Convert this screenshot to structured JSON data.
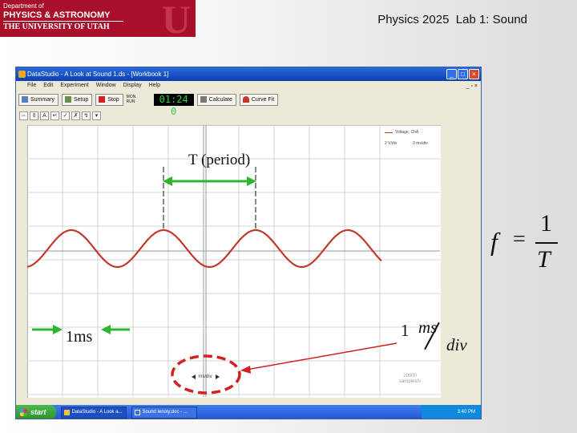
{
  "header": {
    "logo_line1": "Department of",
    "logo_line2": "PHYSICS & ASTRONOMY",
    "logo_line3": "THE UNIVERSITY OF UTAH",
    "logo_mark": "U",
    "slide_title": "Physics 2025  Lab 1: Sound"
  },
  "window": {
    "title": "DataStudio - A Look at Sound 1.ds - [Workbook 1]",
    "menu": [
      "File",
      "Edit",
      "Experiment",
      "Window",
      "Display",
      "Help"
    ],
    "sys_controls": "_ ▫ ×",
    "controls": [
      "_",
      "□",
      "×"
    ],
    "toolbar": {
      "summary": "Summary",
      "setup": "Setup",
      "stop": "Stop",
      "rate_top": "MON",
      "rate_bottom": "RUN",
      "timer": "01:24 0",
      "calculate": "Calculate",
      "curve_fit": "Curve Fit"
    },
    "mini_tools": [
      "⇔",
      "⇕",
      "A",
      "↵",
      "✓",
      "✗",
      "↯",
      "▾"
    ],
    "legend": {
      "series": "Voltage, ChA",
      "left_value": "2",
      "left_unit": "V/div",
      "right_value": "3",
      "right_unit": "ms/div"
    },
    "samples_line1": "20000",
    "samples_line2": "samples/s",
    "zoom_label": "ms/div",
    "taskbar": {
      "start": "start",
      "tasks": [
        "DataStudio - A Look a...",
        "Sound lenoty.doc - ..."
      ],
      "clock": "3:40 PM"
    }
  },
  "annotations": {
    "period_label": "T (period)",
    "ms_label": "1ms",
    "scale_one": "1",
    "scale_ms": "ms",
    "scale_div": "div",
    "formula_f": "f",
    "formula_eq": "=",
    "formula_num": "1",
    "formula_den": "T"
  },
  "colors": {
    "wave": "#c0392b",
    "arrow_green": "#2db52d",
    "ellipse_red": "#d42020",
    "logo_red": "#a8102a"
  }
}
